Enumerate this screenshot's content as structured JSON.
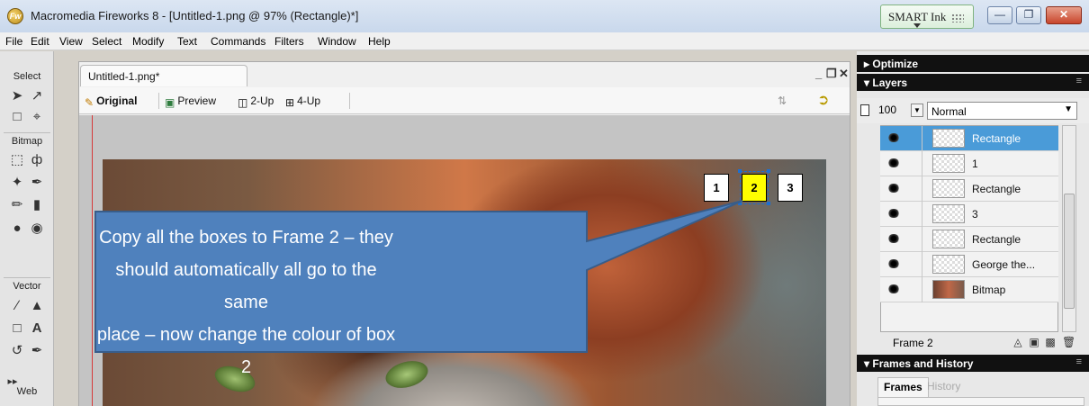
{
  "window": {
    "title": "Macromedia Fireworks 8 - [Untitled-1.png @ 97% (Rectangle)*]",
    "app_icon_letter": "Fw"
  },
  "smart_ink": {
    "label": "SMART Ink"
  },
  "menu": [
    "File",
    "Edit",
    "View",
    "Select",
    "Modify",
    "Text",
    "Commands",
    "Filters",
    "Window",
    "Help"
  ],
  "tools": {
    "select_header": "Select",
    "bitmap_header": "Bitmap",
    "vector_header": "Vector",
    "web_header": "Web"
  },
  "document": {
    "tab_label": "Untitled-1.png*",
    "view_modes": [
      "Original",
      "Preview",
      "2-Up",
      "4-Up"
    ]
  },
  "boxes": [
    "1",
    "2",
    "3"
  ],
  "callout": {
    "text": "Copy all the boxes to Frame 2 – they should automatically all go to the same place – now change the colour of box 2",
    "lines": [
      "Copy all the boxes to Frame 2 – they",
      "should automatically all go to the same",
      "place – now change the colour of box 2"
    ]
  },
  "panels": {
    "optimize": "Optimize",
    "layers": "Layers",
    "opacity": "100",
    "blend_mode": "Normal",
    "layer_items": [
      {
        "name": "Rectangle",
        "active": true
      },
      {
        "name": "1",
        "active": false
      },
      {
        "name": "Rectangle",
        "active": false
      },
      {
        "name": "3",
        "active": false
      },
      {
        "name": "Rectangle",
        "active": false
      },
      {
        "name": "George the...",
        "active": false
      },
      {
        "name": "Bitmap",
        "active": false
      }
    ],
    "frame_label": "Frame 2",
    "frames_history": "Frames and History",
    "frames_tab": "Frames",
    "history_tab": "History"
  },
  "colors": {
    "callout_fill": "#4f81bd",
    "callout_stroke": "#385d8a",
    "selected_box": "#ffff00",
    "active_layer": "#4a9bd8"
  }
}
